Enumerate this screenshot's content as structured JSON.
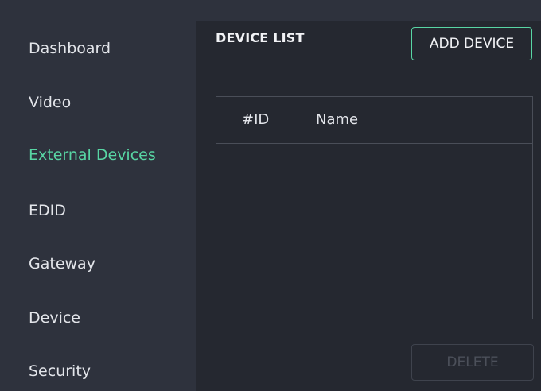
{
  "sidebar": {
    "items": [
      {
        "label": "Dashboard",
        "active": false
      },
      {
        "label": "Video",
        "active": false
      },
      {
        "label": "External Devices",
        "active": true
      },
      {
        "label": "EDID",
        "active": false
      },
      {
        "label": "Gateway",
        "active": false
      },
      {
        "label": "Device",
        "active": false
      },
      {
        "label": "Security",
        "active": false
      }
    ]
  },
  "main": {
    "title": "DEVICE LIST",
    "add_button_label": "ADD DEVICE",
    "table": {
      "columns": [
        "#ID",
        "Name"
      ],
      "rows": []
    },
    "delete_button_label": "DELETE"
  },
  "colors": {
    "accent": "#58d6a4",
    "sidebar_bg": "#2e323d",
    "content_bg": "#252830",
    "text": "#e3e5ea",
    "disabled_text": "#4c505a"
  }
}
